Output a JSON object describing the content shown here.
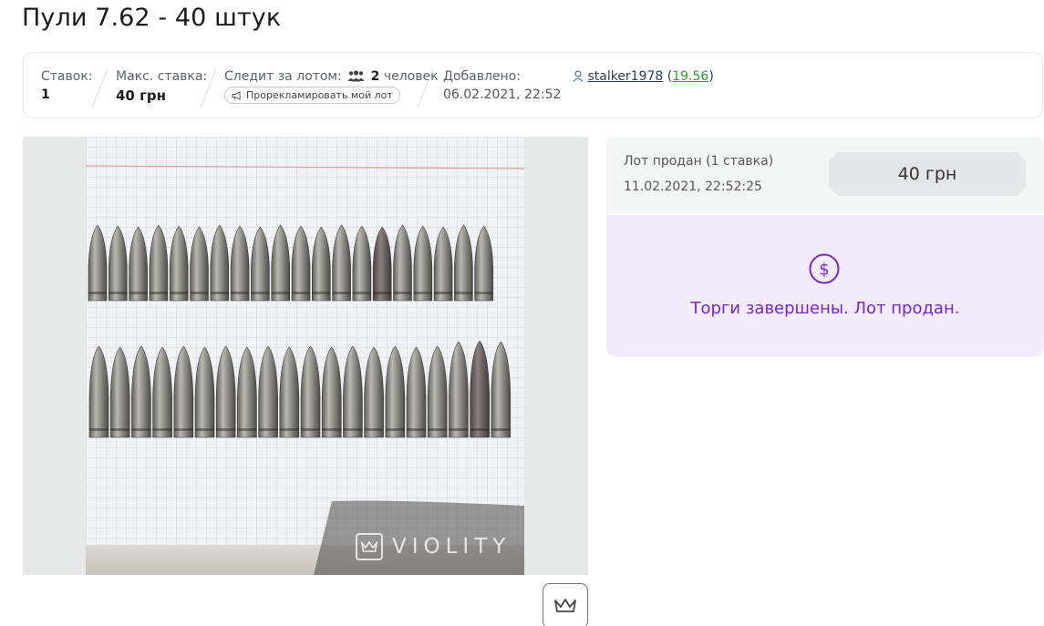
{
  "page": {
    "title": "Пули 7.62 - 40 штук"
  },
  "info": {
    "bids_label": "Ставок:",
    "bids_value": "1",
    "max_bid_label": "Макс. ставка:",
    "max_bid_value": "40 грн",
    "watching_label": "Следит за лотом:",
    "watching_count": "2",
    "watching_suffix": "человек",
    "promote_label": "Прорекламировать мой лот",
    "added_label": "Добавлено:",
    "added_value": "06.02.2021, 22:52",
    "seller_name": "stalker1978",
    "seller_rating": "19.56"
  },
  "photo": {
    "watermark": "VIOLITY"
  },
  "sale": {
    "status": "Лот продан (1 ставка)",
    "date": "11.02.2021, 22:52:25",
    "price": "40 грн",
    "ended_message": "Торги завершены. Лот продан."
  },
  "colors": {
    "accent_purple": "#7427c3",
    "ended_bg": "#f3ebfb",
    "rating_green": "#2e9c2e"
  },
  "icons": [
    "people-icon",
    "megaphone-icon",
    "user-icon",
    "crown-icon",
    "dollar-circle-icon"
  ]
}
